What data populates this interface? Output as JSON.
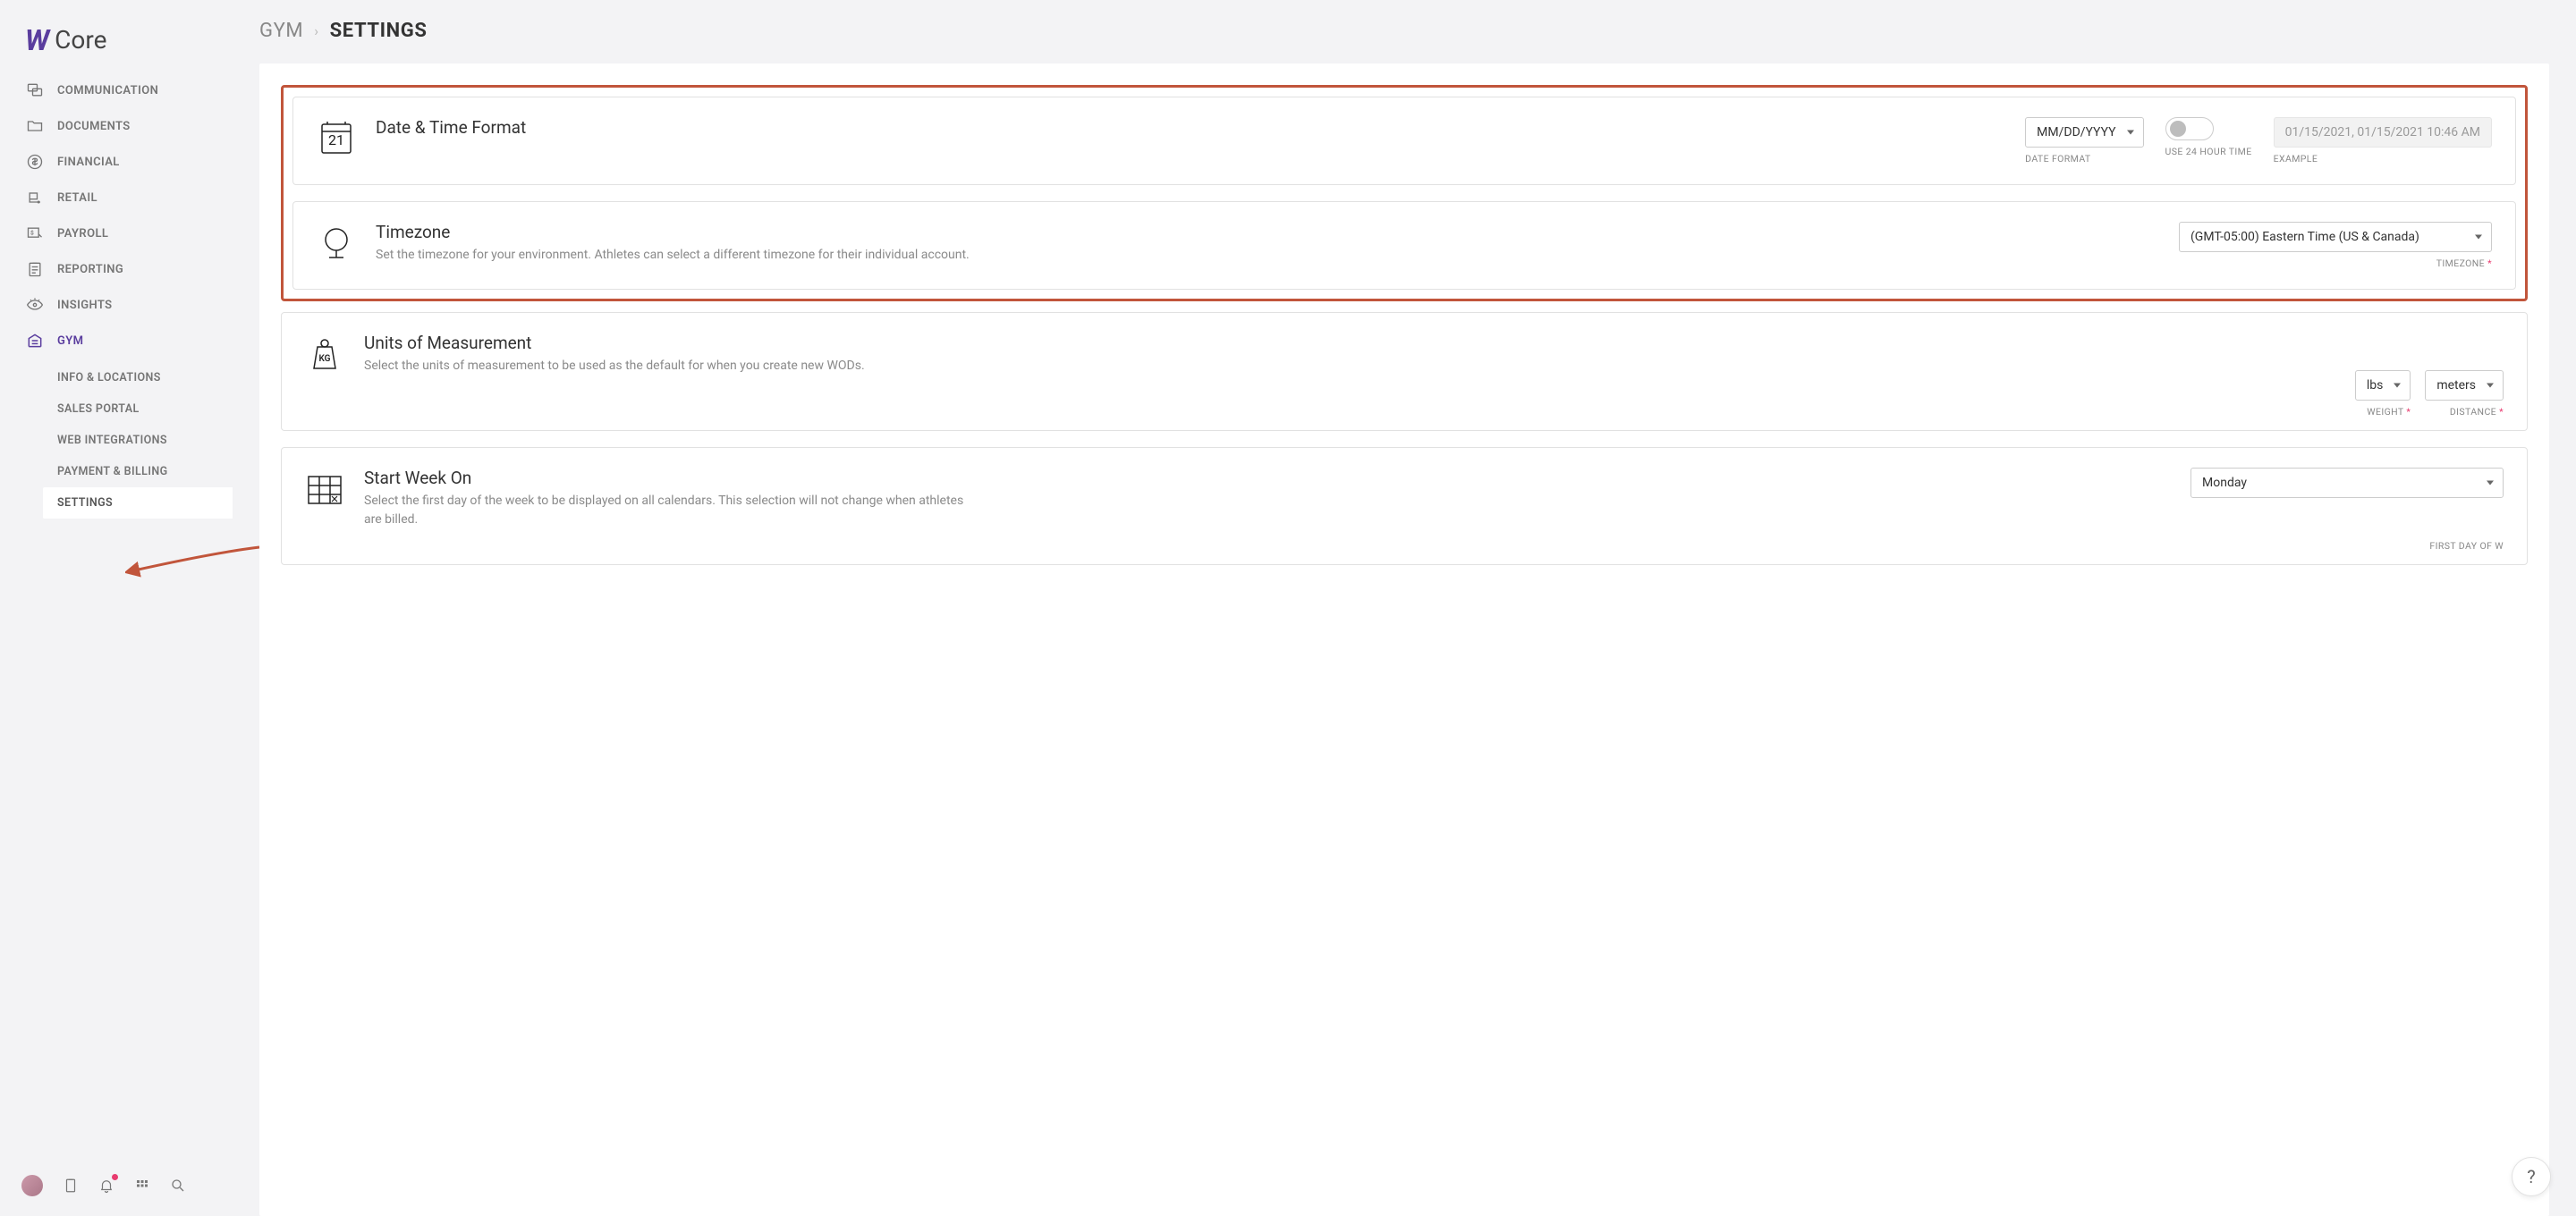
{
  "logo_text": "Core",
  "nav": [
    {
      "label": "COMMUNICATION"
    },
    {
      "label": "DOCUMENTS"
    },
    {
      "label": "FINANCIAL"
    },
    {
      "label": "RETAIL"
    },
    {
      "label": "PAYROLL"
    },
    {
      "label": "REPORTING"
    },
    {
      "label": "INSIGHTS"
    },
    {
      "label": "GYM"
    }
  ],
  "subnav": [
    {
      "label": "INFO & LOCATIONS"
    },
    {
      "label": "SALES PORTAL"
    },
    {
      "label": "WEB INTEGRATIONS"
    },
    {
      "label": "PAYMENT & BILLING"
    },
    {
      "label": "SETTINGS"
    }
  ],
  "breadcrumb": {
    "parent": "GYM",
    "current": "SETTINGS"
  },
  "datetime": {
    "title": "Date & Time Format",
    "date_format_label": "DATE FORMAT",
    "date_format_value": "MM/DD/YYYY",
    "use_24h_label": "USE 24 HOUR TIME",
    "example_label": "EXAMPLE",
    "example_value": "01/15/2021, 01/15/2021 10:46 AM"
  },
  "timezone": {
    "title": "Timezone",
    "desc": "Set the timezone for your environment. Athletes can select a different timezone for their individual account.",
    "value": "(GMT-05:00) Eastern Time (US & Canada)",
    "label": "TIMEZONE"
  },
  "units": {
    "title": "Units of Measurement",
    "desc": "Select the units of measurement to be used as the default for when you create new WODs.",
    "weight_value": "lbs",
    "weight_label": "WEIGHT",
    "distance_value": "meters",
    "distance_label": "DISTANCE"
  },
  "week": {
    "title": "Start Week On",
    "desc": "Select the first day of the week to be displayed on all calendars. This selection will not change when athletes are billed.",
    "value": "Monday",
    "label": "FIRST DAY OF W"
  },
  "calendar_day": "21",
  "kg_label": "KG",
  "help": "?"
}
